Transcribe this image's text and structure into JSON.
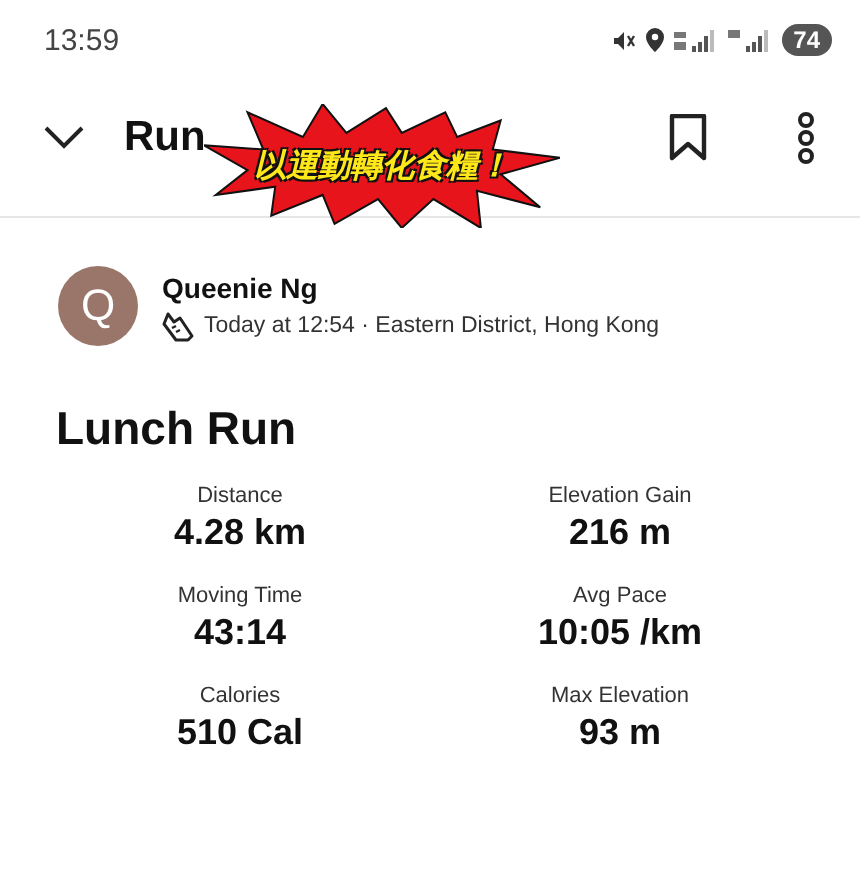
{
  "status_bar": {
    "time": "13:59",
    "battery": "74"
  },
  "header": {
    "title": "Run",
    "bookmarked": false
  },
  "sticker": {
    "text": "以運動轉化食糧！"
  },
  "athlete": {
    "initial": "Q",
    "name": "Queenie Ng",
    "meta": "Today at 12:54 · Eastern District, Hong Kong"
  },
  "activity": {
    "title": "Lunch Run"
  },
  "stats": [
    {
      "label": "Distance",
      "value": "4.28 km"
    },
    {
      "label": "Elevation Gain",
      "value": "216 m"
    },
    {
      "label": "Moving Time",
      "value": "43:14"
    },
    {
      "label": "Avg Pace",
      "value": "10:05 /km"
    },
    {
      "label": "Calories",
      "value": "510 Cal"
    },
    {
      "label": "Max Elevation",
      "value": "93 m"
    }
  ]
}
